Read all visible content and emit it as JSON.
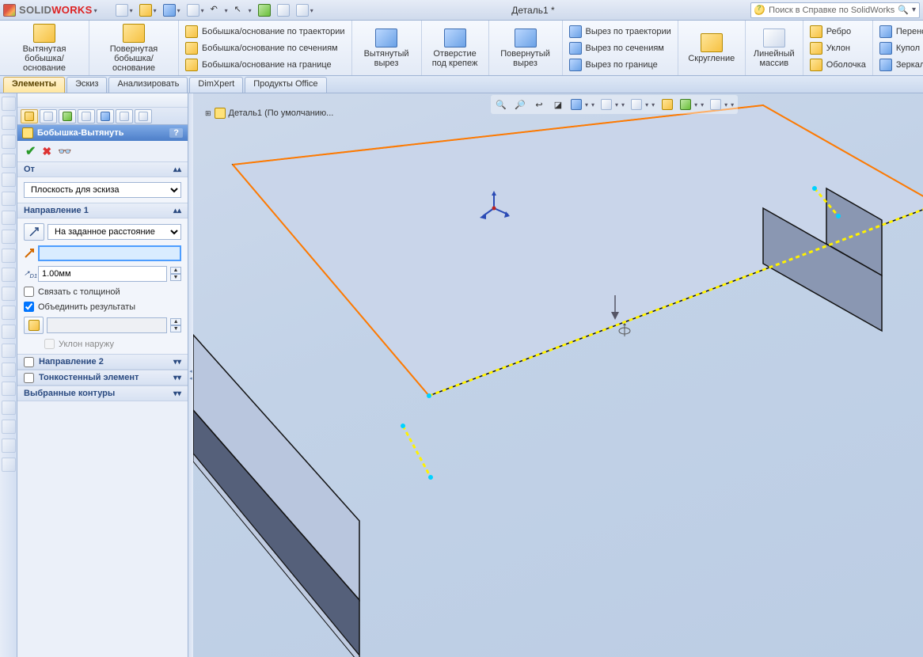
{
  "app": {
    "brand_solid": "SOLID",
    "brand_works": "WORKS"
  },
  "document_title": "Деталь1 *",
  "search": {
    "placeholder": "Поиск в Справке по SolidWorks"
  },
  "ribbon": {
    "extruded_boss": "Вытянутая бобышка/основание",
    "revolved_boss": "Повернутая бобышка/основание",
    "swept_boss": "Бобышка/основание по траектории",
    "lofted_boss": "Бобышка/основание по сечениям",
    "boundary_boss": "Бобышка/основание на границе",
    "extruded_cut": "Вытянутый вырез",
    "hole_wizard": "Отверстие под крепеж",
    "revolved_cut": "Повернутый вырез",
    "swept_cut": "Вырез по траектории",
    "lofted_cut": "Вырез по сечениям",
    "boundary_cut": "Вырез по границе",
    "fillet": "Скругление",
    "linear_pattern": "Линейный массив",
    "rib": "Ребро",
    "draft": "Уклон",
    "shell": "Оболочка",
    "move": "Перенос",
    "dome": "Купол",
    "mirror": "Зеркальное отражение"
  },
  "tabs": {
    "features": "Элементы",
    "sketch": "Эскиз",
    "evaluate": "Анализировать",
    "dimxpert": "DimXpert",
    "office": "Продукты Office"
  },
  "breadcrumb": "Деталь1  (По умолчанию...",
  "feature_mgr": {
    "title": "Бобышка-Вытянуть",
    "help": "?",
    "from_section": "От",
    "from_plane": "Плоскость для эскиза",
    "dir1_section": "Направление 1",
    "end_condition": "На заданное расстояние",
    "depth": "1.00мм",
    "depth_value": "",
    "merge_thickness": "Связать с толщиной",
    "merge_result": "Объединить результаты",
    "draft_outward": "Уклон наружу",
    "draft_value": "",
    "dir2_section": "Направление 2",
    "thin_section": "Тонкостенный элемент",
    "contours_section": "Выбранные контуры"
  }
}
